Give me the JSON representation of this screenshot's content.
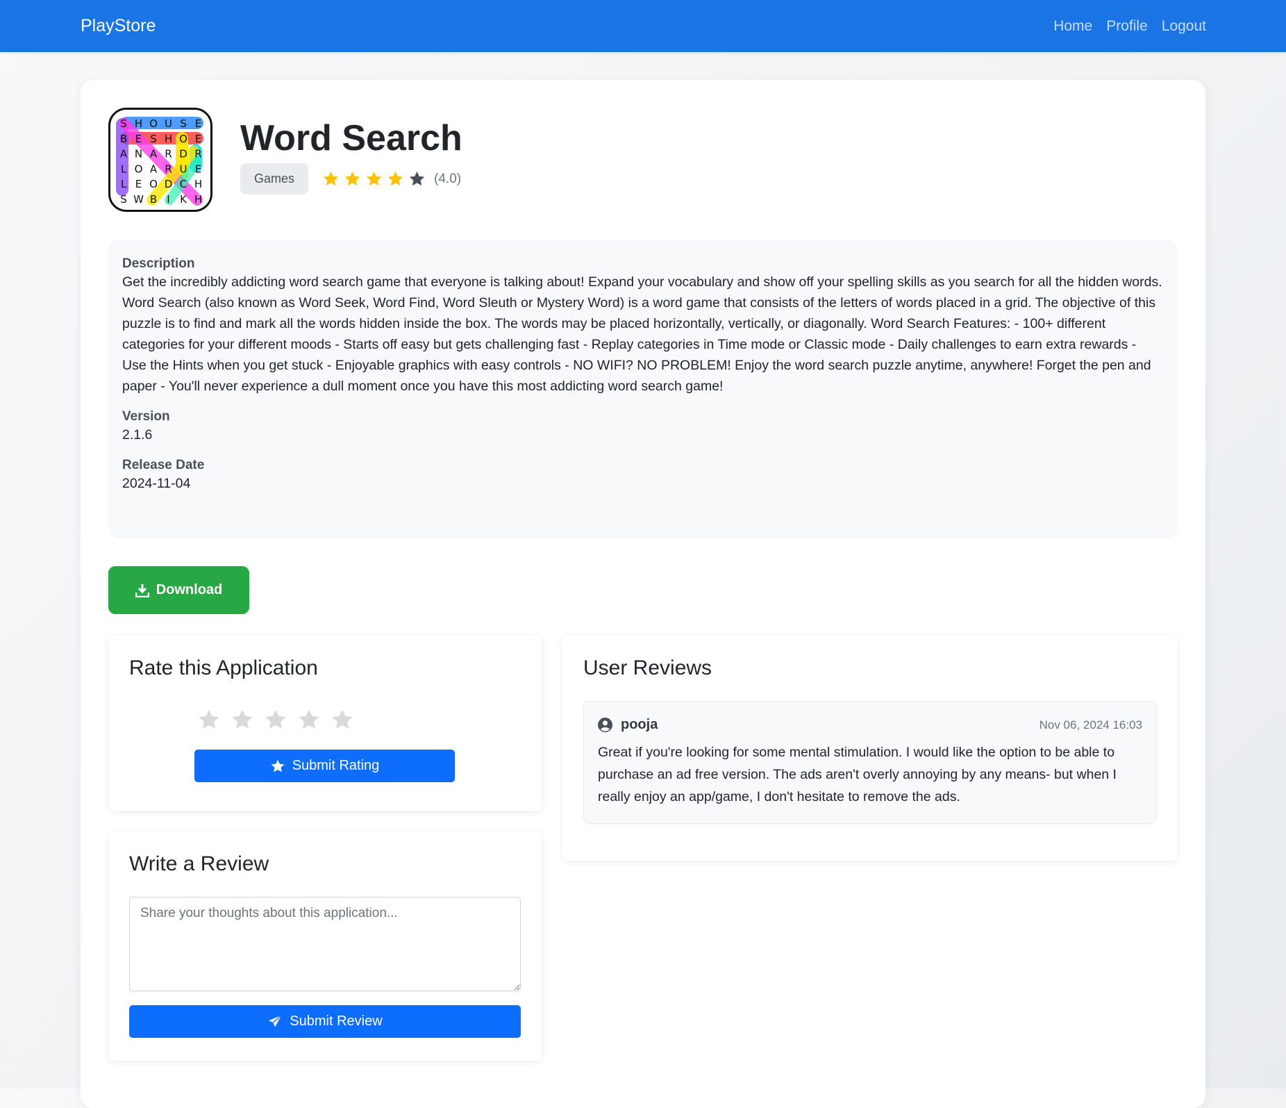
{
  "nav": {
    "brand": "PlayStore",
    "links": [
      "Home",
      "Profile",
      "Logout"
    ]
  },
  "app": {
    "title": "Word Search",
    "category": "Games",
    "rating": 4.0,
    "rating_text": "(4.0)",
    "icon_letters": [
      "SHOUSE",
      "BESHOE",
      "ANARDR",
      "LOARUE",
      "LEODCH",
      "SWBIKH"
    ]
  },
  "details": {
    "description_label": "Description",
    "description": "Get the incredibly addicting word search game that everyone is talking about! Expand your vocabulary and show off your spelling skills as you search for all the hidden words. Word Search (also known as Word Seek, Word Find, Word Sleuth or Mystery Word) is a word game that consists of the letters of words placed in a grid. The objective of this puzzle is to find and mark all the words hidden inside the box. The words may be placed horizontally, vertically, or diagonally. Word Search Features: - 100+ different categories for your different moods - Starts off easy but gets challenging fast - Replay categories in Time mode or Classic mode - Daily challenges to earn extra rewards - Use the Hints when you get stuck - Enjoyable graphics with easy controls - NO WIFI? NO PROBLEM! Enjoy the word search puzzle anytime, anywhere! Forget the pen and paper - You'll never experience a dull moment once you have this most addicting word search game!",
    "version_label": "Version",
    "version": "2.1.6",
    "release_label": "Release Date",
    "release_date": "2024-11-04"
  },
  "download_label": "Download",
  "rate": {
    "title": "Rate this Application",
    "selected": 0,
    "submit_label": "Submit Rating"
  },
  "write_review": {
    "title": "Write a Review",
    "placeholder": "Share your thoughts about this application...",
    "value": "",
    "submit_label": "Submit Review"
  },
  "reviews": {
    "title": "User Reviews",
    "items": [
      {
        "user": "pooja",
        "date": "Nov 06, 2024 16:03",
        "text": "Great if you're looking for some mental stimulation. I would like the option to be able to purchase an ad free version. The ads aren't overly annoying by any means- but when I really enjoy an app/game, I don't hesitate to remove the ads."
      }
    ]
  },
  "colors": {
    "navbar": "#1b74e4",
    "star_filled": "#ffc107",
    "star_empty": "#495057",
    "download": "#28a745",
    "primary": "#0d6efd"
  }
}
